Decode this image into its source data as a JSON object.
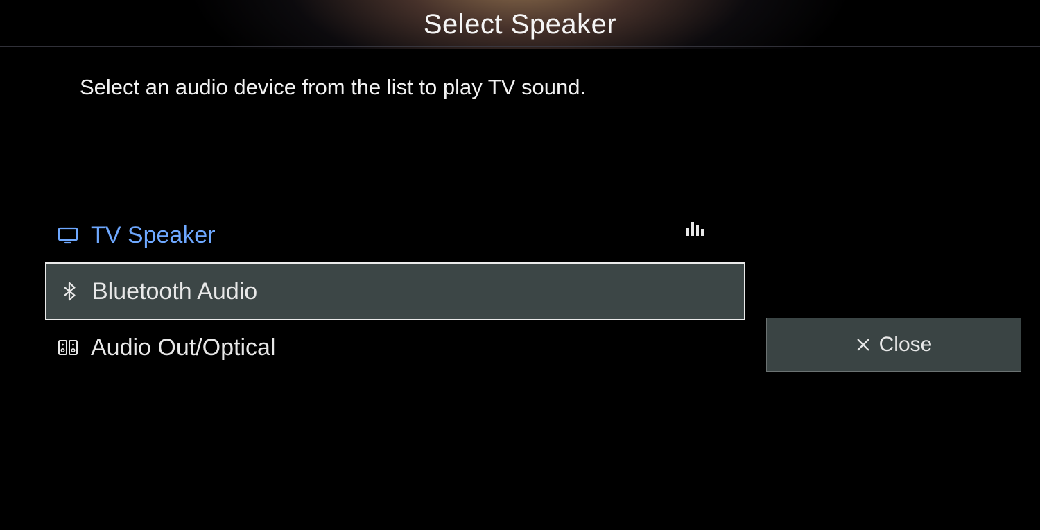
{
  "header": {
    "title": "Select Speaker"
  },
  "subtitle": "Select an audio device from the list to play TV sound.",
  "devices": [
    {
      "label": "TV Speaker",
      "icon": "tv"
    },
    {
      "label": "Bluetooth Audio",
      "icon": "bluetooth"
    },
    {
      "label": "Audio Out/Optical",
      "icon": "output"
    }
  ],
  "close": {
    "label": "Close"
  }
}
